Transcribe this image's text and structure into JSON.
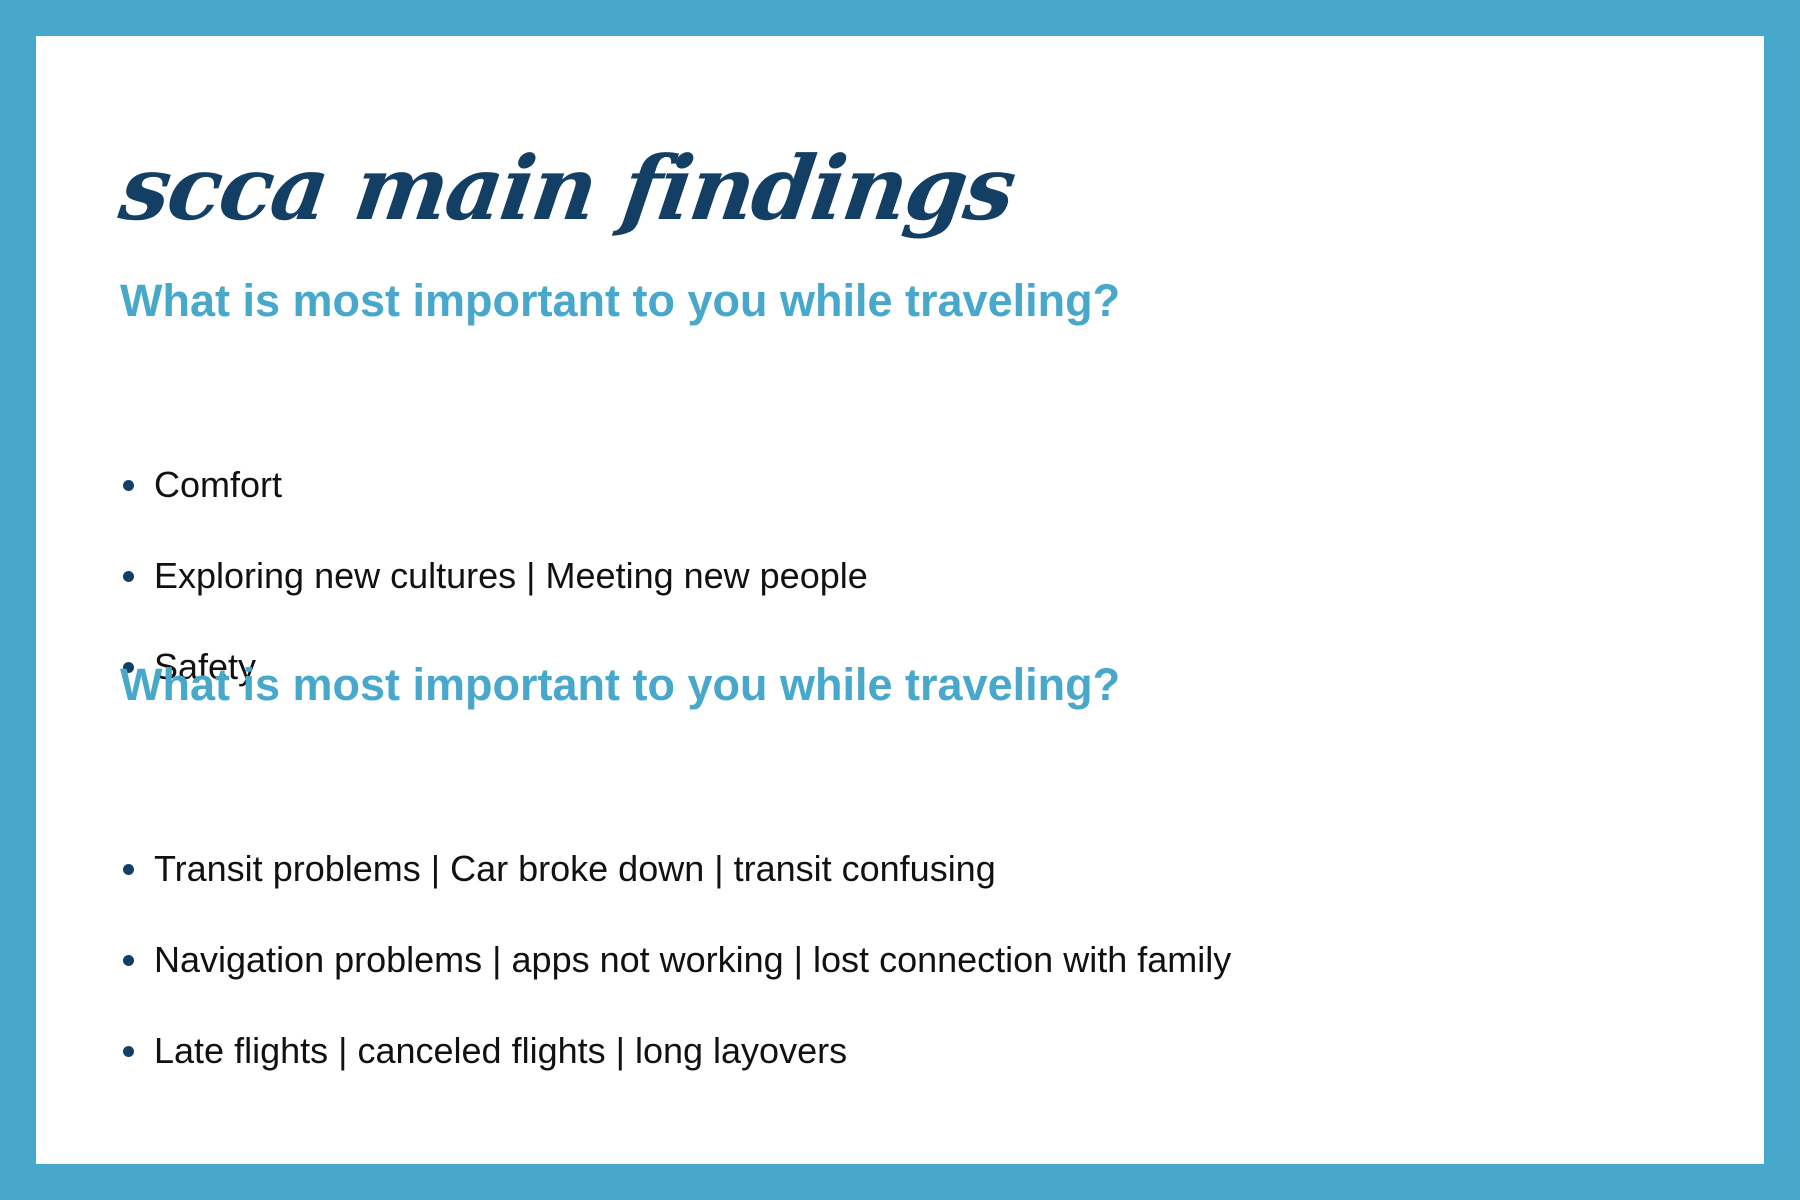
{
  "title": "scca main findings",
  "sections": [
    {
      "question": "What is most important to you while traveling?",
      "items": [
        "Comfort",
        "Exploring new cultures | Meeting new people",
        "Safety"
      ]
    },
    {
      "question": "What is most important to you while traveling?",
      "items": [
        "Transit problems | Car broke down | transit confusing",
        "Navigation problems | apps not working | lost connection with family",
        "Late flights | canceled flights | long layovers"
      ]
    }
  ],
  "colors": {
    "border": "#47a8cc",
    "background": "#ffffff",
    "title": "#123f63",
    "question": "#47a8cc",
    "bullet": "#123f63",
    "text": "#111111"
  }
}
